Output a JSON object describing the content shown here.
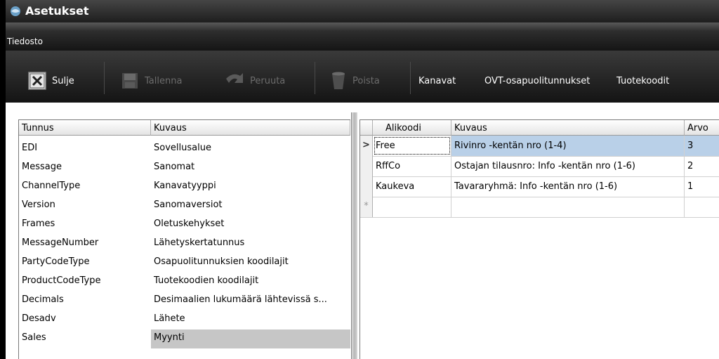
{
  "window": {
    "title": "Asetukset"
  },
  "menu": {
    "file_label": "Tiedosto"
  },
  "toolbar": {
    "close_label": "Sulje",
    "save_label": "Tallenna",
    "undo_label": "Peruuta",
    "delete_label": "Poista",
    "channels_label": "Kanavat",
    "ovt_label": "OVT-osapuolitunnukset",
    "product_codes_label": "Tuotekoodit"
  },
  "settings_table": {
    "headers": [
      "Tunnus",
      "Kuvaus"
    ],
    "rows": [
      [
        "EDI",
        "Sovellusalue"
      ],
      [
        "Message",
        "Sanomat"
      ],
      [
        "ChannelType",
        "Kanavatyyppi"
      ],
      [
        "Version",
        "Sanomaversiot"
      ],
      [
        "Frames",
        "Oletuskehykset"
      ],
      [
        "MessageNumber",
        "Lähetyskertatunnus"
      ],
      [
        "PartyCodeType",
        "Osapuolitunnuksien koodilajit"
      ],
      [
        "ProductCodeType",
        "Tuotekoodien koodilajit"
      ],
      [
        "Decimals",
        "Desimaalien lukumäärä lähtevissä s..."
      ],
      [
        "Desadv",
        "Lähete"
      ],
      [
        "Sales",
        "Myynti"
      ]
    ],
    "selected_row": "Sales"
  },
  "subcode_table": {
    "headers": [
      "Alikoodi",
      "Kuvaus",
      "Arvo"
    ],
    "rows": [
      [
        "Free",
        "Rivinro -kentän nro (1-4)",
        "3"
      ],
      [
        "RffCo",
        "Ostajan tilausnro: Info -kentän nro (1-6)",
        "2"
      ],
      [
        "Kaukeva",
        "Tavararyhmä: Info -kentän nro (1-6)",
        "1"
      ]
    ],
    "current_row_marker": ">",
    "new_row_marker": "*"
  },
  "colors": {
    "selection": "#b9d0e8",
    "row_selected": "#c6c6c6"
  }
}
